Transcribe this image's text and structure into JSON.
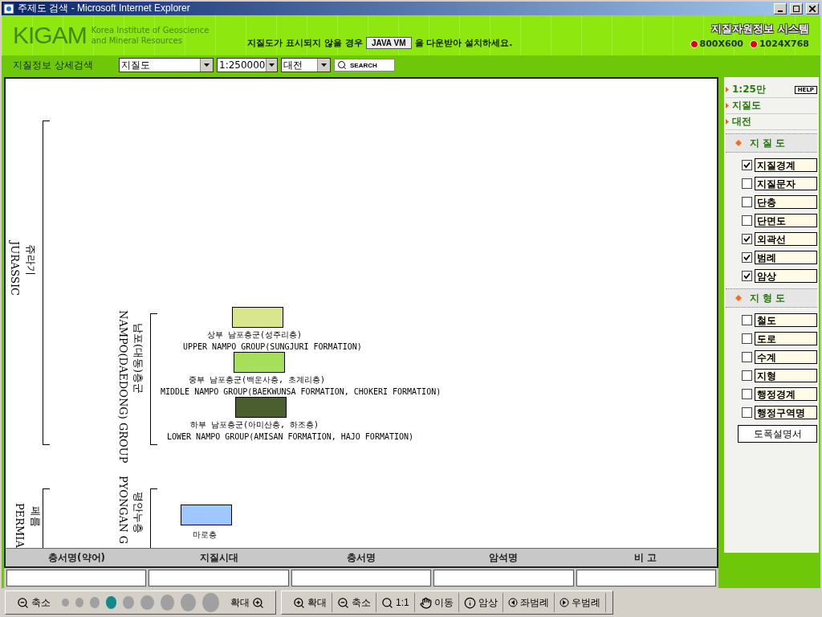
{
  "window": {
    "title": "주제도 검색 - Microsoft Internet Explorer"
  },
  "header": {
    "logo": "KIGAM",
    "org_lines": [
      "Korea Institute of Geoscience",
      "and Mineral Resources"
    ],
    "notice_before": "지질도가 표시되지 않을 경우",
    "notice_button": "JAVA VM",
    "notice_after": "을 다운받아 설치하세요.",
    "system_title": "지질자원정보 시스템",
    "resolutions": [
      "800X600",
      "1024X768"
    ]
  },
  "search": {
    "label": "지질정보 상세검색",
    "selects": [
      {
        "value": "지질도"
      },
      {
        "value": "1:250000"
      },
      {
        "value": "대전"
      }
    ],
    "button": "SEARCH"
  },
  "legend": {
    "periods": [
      {
        "name_ko": "쥬라기",
        "name_en": "JURASSIC",
        "groups": [
          {
            "name_ko": "남포(대동)층군",
            "name_en": "NAMPO(DAEDONG) GROUP",
            "units": [
              {
                "name_ko": "상부 남포층군(성주리층)",
                "name_en": "UPPER NAMPO GROUP(SUNGJURI FORMATION)",
                "color": "#d9e68c"
              },
              {
                "name_ko": "중부 남포층군(백운사층, 초계리층)",
                "name_en": "MIDDLE NAMPO GROUP(BAEKWUNSA FORMATION, CHOKERI FORMATION)",
                "color": "#a6e05a"
              },
              {
                "name_ko": "하부 남포층군(아미산층, 하조층)",
                "name_en": "LOWER NAMPO GROUP(AMISAN FORMATION, HAJO FORMATION)",
                "color": "#4a5e2e"
              }
            ]
          }
        ]
      },
      {
        "name_ko": "페름",
        "name_en": "PERMIA",
        "groups": [
          {
            "name_ko": "평안누층",
            "name_en": "PYONGAN G",
            "units": [
              {
                "name_ko": "마로층",
                "color": "#9ec8ff"
              }
            ]
          }
        ]
      }
    ]
  },
  "table": {
    "columns": [
      "층서명(약어)",
      "지질시대",
      "층서명",
      "암석명",
      "비 고"
    ]
  },
  "sidebar": {
    "nav": [
      {
        "label": "1:25만",
        "help": "HELP"
      },
      {
        "label": "지질도"
      },
      {
        "label": "대전"
      }
    ],
    "sections": [
      {
        "title": "지 질 도",
        "layers": [
          {
            "label": "지질경계",
            "checked": true
          },
          {
            "label": "지질문자",
            "checked": false
          },
          {
            "label": "단층",
            "checked": false
          },
          {
            "label": "단면도",
            "checked": false
          },
          {
            "label": "외곽선",
            "checked": true
          },
          {
            "label": "범례",
            "checked": true
          },
          {
            "label": "암상",
            "checked": true
          }
        ]
      },
      {
        "title": "지 형 도",
        "layers": [
          {
            "label": "철도",
            "checked": false
          },
          {
            "label": "도로",
            "checked": false
          },
          {
            "label": "수계",
            "checked": false
          },
          {
            "label": "지형",
            "checked": false
          },
          {
            "label": "행정경계",
            "checked": false
          },
          {
            "label": "행정구역명",
            "checked": false
          }
        ]
      }
    ],
    "button": "도폭설명서"
  },
  "toolbar": {
    "zoom_out": "축소",
    "zoom_in": "확대",
    "zoom_steps": [
      {
        "selected": false
      },
      {
        "selected": false
      },
      {
        "selected": false
      },
      {
        "selected": true
      },
      {
        "selected": false
      },
      {
        "selected": false
      },
      {
        "selected": false
      },
      {
        "selected": false
      },
      {
        "selected": false
      }
    ],
    "tools": [
      {
        "kind": "zoomin",
        "label": "확대"
      },
      {
        "kind": "zoomout",
        "label": "축소"
      },
      {
        "kind": "actual",
        "label": "1:1"
      },
      {
        "kind": "pan",
        "label": "이동"
      },
      {
        "kind": "info",
        "label": "암상"
      },
      {
        "kind": "left",
        "label": "좌범례"
      },
      {
        "kind": "right",
        "label": "우범례"
      }
    ]
  }
}
